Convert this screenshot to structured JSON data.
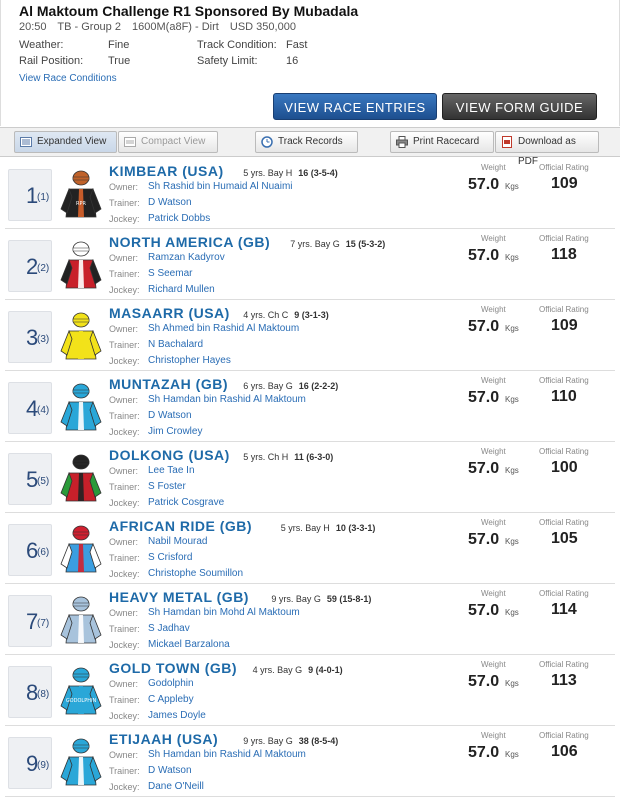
{
  "race": {
    "title": "Al Maktoum Challenge R1 Sponsored By Mubadala",
    "time": "20:50",
    "type": "TB - Group 2",
    "distance": "1600M(a8F) - Dirt",
    "prize": "USD 350,000",
    "weather_label": "Weather:",
    "weather": "Fine",
    "rail_label": "Rail Position:",
    "rail": "True",
    "track_label": "Track Condition:",
    "track": "Fast",
    "safety_label": "Safety Limit:",
    "safety": "16",
    "view_conditions": "View Race Conditions"
  },
  "buttons": {
    "entries": "VIEW RACE ENTRIES",
    "form": "VIEW FORM GUIDE"
  },
  "toolbar": {
    "expanded": "Expanded View",
    "compact": "Compact View",
    "track_records": "Track Records",
    "print": "Print Racecard",
    "pdf": "Download as PDF"
  },
  "labels": {
    "owner": "Owner:",
    "trainer": "Trainer:",
    "jockey": "Jockey:",
    "weight": "Weight",
    "rating": "Official Rating",
    "kgs": "Kgs"
  },
  "runners": [
    {
      "no": "1",
      "draw": "(1)",
      "name": "KIMBEAR (USA)",
      "details": "5 yrs. Bay H",
      "record": "16 (3-5-4)",
      "owner": "Sh Rashid bin Humaid Al Nuaimi",
      "trainer": "D Watson",
      "jockey": "Patrick Dobbs",
      "weight": "57.0",
      "rating": "109",
      "silk": {
        "body": "#222222",
        "sleeve": "#222222",
        "stripe": "#d9632b",
        "cap": "#c0622a",
        "text": "RPR"
      }
    },
    {
      "no": "2",
      "draw": "(2)",
      "name": "NORTH AMERICA (GB)",
      "details": "7 yrs. Bay G",
      "record": "15 (5-3-2)",
      "owner": "Ramzan Kadyrov",
      "trainer": "S Seemar",
      "jockey": "Richard Mullen",
      "weight": "57.0",
      "rating": "118",
      "silk": {
        "body": "#c8202a",
        "sleeve": "#222222",
        "stripe": "#ffffff",
        "cap": "#ffffff",
        "text": ""
      }
    },
    {
      "no": "3",
      "draw": "(3)",
      "name": "MASAARR (USA)",
      "details": "4 yrs. Ch C",
      "record": "9 (3-1-3)",
      "owner": "Sh Ahmed bin Rashid Al Maktoum",
      "trainer": "N Bachalard",
      "jockey": "Christopher Hayes",
      "weight": "57.0",
      "rating": "109",
      "silk": {
        "body": "#f2e21a",
        "sleeve": "#f2e21a",
        "stripe": "#f2e21a",
        "cap": "#f2e21a",
        "text": ""
      }
    },
    {
      "no": "4",
      "draw": "(4)",
      "name": "MUNTAZAH (GB)",
      "details": "6 yrs. Bay G",
      "record": "16 (2-2-2)",
      "owner": "Sh Hamdan bin Rashid Al Maktoum",
      "trainer": "D Watson",
      "jockey": "Jim Crowley",
      "weight": "57.0",
      "rating": "110",
      "silk": {
        "body": "#2aa7d8",
        "sleeve": "#2aa7d8",
        "stripe": "#ffffff",
        "cap": "#2aa7d8",
        "text": ""
      }
    },
    {
      "no": "5",
      "draw": "(5)",
      "name": "DOLKONG (USA)",
      "details": "5 yrs. Ch H",
      "record": "11 (6-3-0)",
      "owner": "Lee Tae In",
      "trainer": "S Foster",
      "jockey": "Patrick Cosgrave",
      "weight": "57.0",
      "rating": "100",
      "silk": {
        "body": "#c8202a",
        "sleeve": "#2b9a3a",
        "stripe": "#222222",
        "cap": "#222222",
        "text": ""
      }
    },
    {
      "no": "6",
      "draw": "(6)",
      "name": "AFRICAN RIDE (GB)",
      "details": "5 yrs. Bay H",
      "record": "10 (3-3-1)",
      "owner": "Nabil Mourad",
      "trainer": "S Crisford",
      "jockey": "Christophe Soumillon",
      "weight": "57.0",
      "rating": "105",
      "silk": {
        "body": "#3b9ee0",
        "sleeve": "#ffffff",
        "stripe": "#d02030",
        "cap": "#d02030",
        "text": ""
      }
    },
    {
      "no": "7",
      "draw": "(7)",
      "name": "HEAVY METAL (GB)",
      "details": "9 yrs. Bay G",
      "record": "59 (15-8-1)",
      "owner": "Sh Hamdan bin Mohd Al Maktoum",
      "trainer": "S Jadhav",
      "jockey": "Mickael Barzalona",
      "weight": "57.0",
      "rating": "114",
      "silk": {
        "body": "#a8c3dc",
        "sleeve": "#a8c3dc",
        "stripe": "#ffffff",
        "cap": "#a8c3dc",
        "text": ""
      }
    },
    {
      "no": "8",
      "draw": "(8)",
      "name": "GOLD TOWN (GB)",
      "details": "4 yrs. Bay G",
      "record": "9 (4-0-1)",
      "owner": "Godolphin",
      "trainer": "C Appleby",
      "jockey": "James Doyle",
      "weight": "57.0",
      "rating": "113",
      "silk": {
        "body": "#2aa7d8",
        "sleeve": "#2aa7d8",
        "stripe": "#2aa7d8",
        "cap": "#2aa7d8",
        "text": "GODOLPHIN"
      }
    },
    {
      "no": "9",
      "draw": "(9)",
      "name": "ETIJAAH (USA)",
      "details": "9 yrs. Bay G",
      "record": "38 (8-5-4)",
      "owner": "Sh Hamdan bin Rashid Al Maktoum",
      "trainer": "D Watson",
      "jockey": "Dane O'Neill",
      "weight": "57.0",
      "rating": "106",
      "silk": {
        "body": "#2aa7d8",
        "sleeve": "#2aa7d8",
        "stripe": "#ffffff",
        "cap": "#2aa7d8",
        "text": ""
      }
    }
  ]
}
